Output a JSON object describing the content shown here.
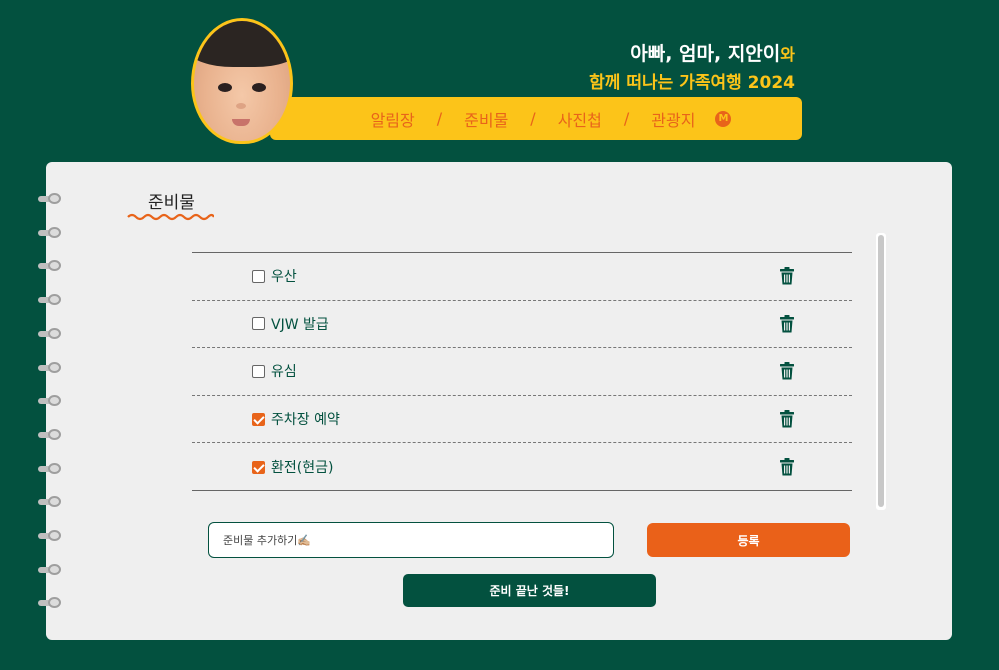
{
  "header": {
    "title_line1_main": "아빠, 엄마, 지안이",
    "title_line1_suffix": "와",
    "title_line2": "함께 떠나는 가족여행 2024",
    "nav": [
      {
        "label": "알림장"
      },
      {
        "label": "준비물"
      },
      {
        "label": "사진첩"
      },
      {
        "label": "관광지"
      }
    ],
    "nav_separator": "/",
    "nav_badge": "M",
    "avatar_icon": "baby-photo"
  },
  "section": {
    "title": "준비물"
  },
  "checklist": {
    "items": [
      {
        "label": "우산",
        "checked": false
      },
      {
        "label": "VJW 발급",
        "checked": false
      },
      {
        "label": "유심",
        "checked": false
      },
      {
        "label": "주차장 예약",
        "checked": true
      },
      {
        "label": "환전(현금)",
        "checked": true
      }
    ],
    "delete_icon": "trash-icon"
  },
  "form": {
    "placeholder": "준비물 추가하기✍🏼",
    "register_label": "등록",
    "done_label": "준비 끝난 것들!"
  },
  "colors": {
    "background": "#03513f",
    "accent_yellow": "#fcc419",
    "accent_orange": "#ea6119",
    "paper": "#efefef"
  }
}
